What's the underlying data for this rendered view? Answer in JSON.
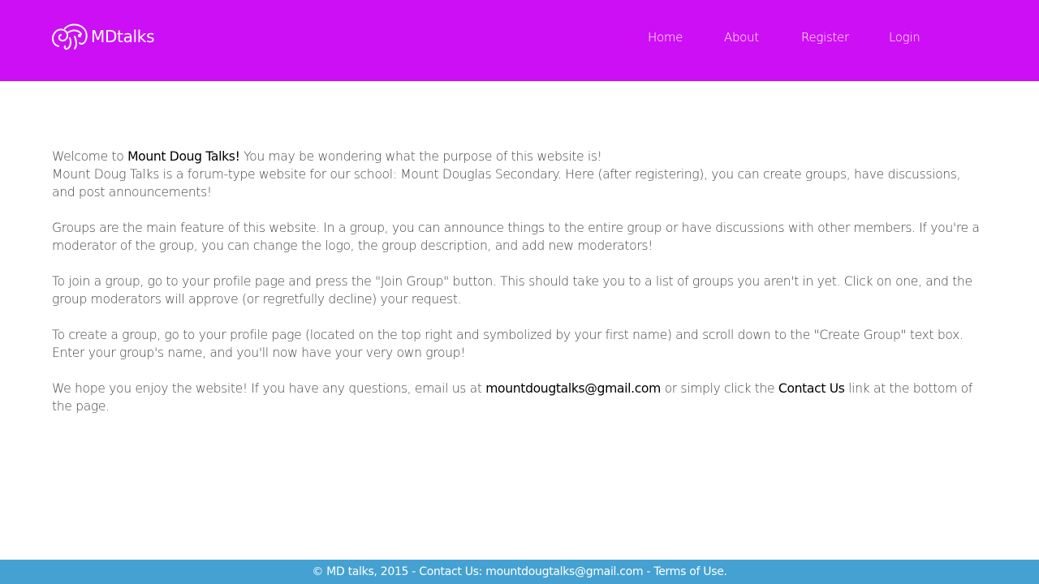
{
  "brand": {
    "name": "MDtalks"
  },
  "nav": {
    "home": "Home",
    "about": "About",
    "register": "Register",
    "login": "Login"
  },
  "content": {
    "p1_a": "Welcome to ",
    "p1_bold": "Mount Doug Talks!",
    "p1_b": " You may be wondering what the purpose of this website is!",
    "p1_line2": "Mount Doug Talks is a forum-type website for our school: Mount Douglas Secondary. Here (after registering), you can create groups, have discussions, and post announcements!",
    "p2": "Groups are the main feature of this website. In a group, you can announce things to the entire group or have discussions with other members. If you're a moderator of the group, you can change the logo, the group description, and add new moderators!",
    "p3": "To join a group, go to your profile page and press the \"Join Group\" button. This should take you to a list of groups you aren't in yet. Click on one, and the group moderators will approve (or regretfully decline) your request.",
    "p4": "To create a group, go to your profile page (located on the top right and symbolized by your first name) and scroll down to the \"Create Group\" text box. Enter your group's name, and you'll now have your very own group!",
    "p5_a": "We hope you enjoy the website! If you have any questions, email us at ",
    "p5_email": "mountdougtalks@gmail.com",
    "p5_b": " or simply click the ",
    "p5_contact": "Contact Us",
    "p5_c": " link at the bottom of the page."
  },
  "footer": {
    "copyright": "© MD talks, 2015 - ",
    "contact": "Contact Us: mountdougtalks@gmail.com",
    "sep": " - ",
    "terms": "Terms of Use."
  },
  "colors": {
    "header_bg": "#cc0ff5",
    "footer_bg": "#44a1d2"
  }
}
